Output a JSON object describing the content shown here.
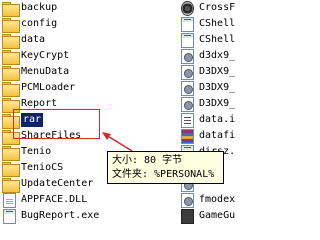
{
  "left_column": {
    "items": [
      {
        "label": "backup",
        "icon": "folder-icon"
      },
      {
        "label": "config",
        "icon": "folder-icon"
      },
      {
        "label": "data",
        "icon": "folder-icon"
      },
      {
        "label": "KeyCrypt",
        "icon": "folder-icon"
      },
      {
        "label": "MenuData",
        "icon": "folder-icon"
      },
      {
        "label": "PCMLoader",
        "icon": "folder-icon"
      },
      {
        "label": "Report",
        "icon": "folder-icon"
      },
      {
        "label": "rar",
        "icon": "folder-icon",
        "selected": true
      },
      {
        "label": "ShareFiles",
        "icon": "folder-icon"
      },
      {
        "label": "Tenio",
        "icon": "folder-icon"
      },
      {
        "label": "TenioCS",
        "icon": "folder-icon"
      },
      {
        "label": "UpdateCenter",
        "icon": "folder-icon"
      },
      {
        "label": "APPFACE.DLL",
        "icon": "dll-file-icon"
      },
      {
        "label": "BugReport.exe",
        "icon": "app-file-icon"
      }
    ]
  },
  "right_column": {
    "items": [
      {
        "label": "CrossF",
        "icon": "disc-file-icon"
      },
      {
        "label": "CShell",
        "icon": "app-file-icon"
      },
      {
        "label": "CShell",
        "icon": "app-file-icon"
      },
      {
        "label": "d3dx9_",
        "icon": "gear-file-icon"
      },
      {
        "label": "D3DX9_",
        "icon": "gear-file-icon"
      },
      {
        "label": "D3DX9_",
        "icon": "gear-file-icon"
      },
      {
        "label": "D3DX9_",
        "icon": "gear-file-icon"
      },
      {
        "label": "data.i",
        "icon": "ini-file-icon"
      },
      {
        "label": "datafi",
        "icon": "rar-file-icon"
      },
      {
        "label": "dirsz.",
        "icon": "app-file-icon"
      },
      {
        "label": "",
        "icon": "gear-file-icon"
      },
      {
        "label": "",
        "icon": "gear-file-icon"
      },
      {
        "label": "fmodex",
        "icon": "gear-file-icon"
      },
      {
        "label": "GameGu",
        "icon": "bat-file-icon"
      }
    ]
  },
  "tooltip": {
    "line1": "大小: 80 字节",
    "line2": "文件夹: %PERSONAL%"
  },
  "colors": {
    "highlight": "#e0242b",
    "selection": "#0a246a",
    "tooltip_bg": "#ffffe1"
  }
}
